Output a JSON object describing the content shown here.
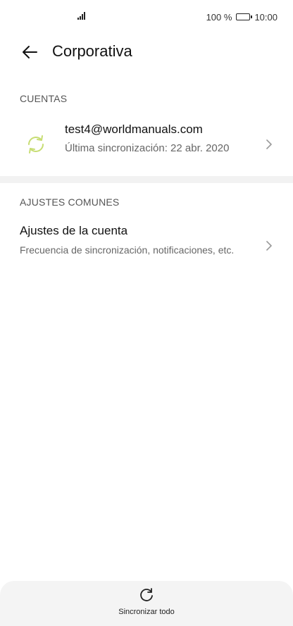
{
  "status_bar": {
    "battery": "100 %",
    "time": "10:00",
    "battery_level": 1.0
  },
  "app_bar": {
    "title": "Corporativa",
    "back_icon": "arrow-left-icon"
  },
  "accounts_section": {
    "header": "CUENTAS",
    "account": {
      "email": "test4@worldmanuals.com",
      "last_sync": "Última sincronización: 22 abr. 2020",
      "icon": "sync-icon",
      "icon_color": "#c7dd73"
    }
  },
  "common_section": {
    "header": "AJUSTES COMUNES",
    "item": {
      "title": "Ajustes de la cuenta",
      "subtitle": "Frecuencia de sincronización, notificaciones, etc."
    }
  },
  "bottom_bar": {
    "sync_all_label": "Sincronizar todo",
    "icon": "refresh-icon"
  }
}
